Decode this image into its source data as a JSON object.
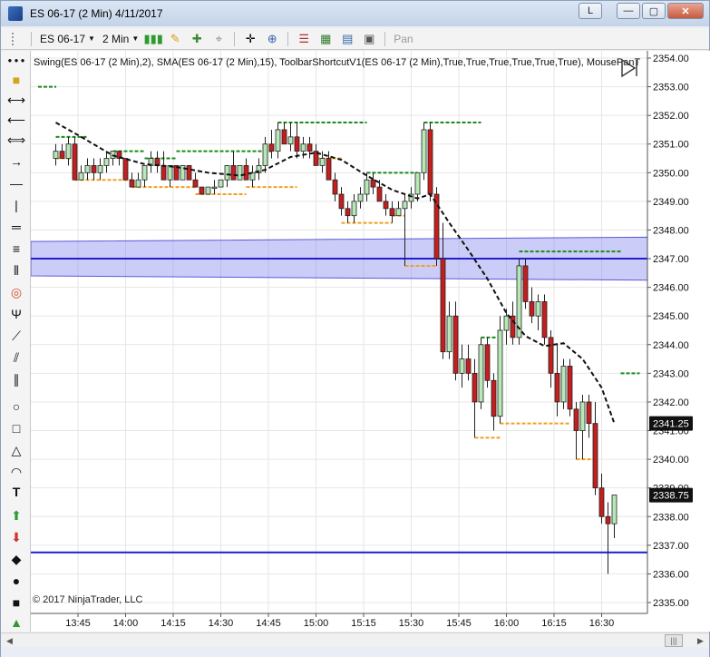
{
  "window": {
    "title": "ES 06-17 (2 Min)  4/11/2017",
    "link_button": "L",
    "minimize": "—",
    "maximize": "▢",
    "close": "✕"
  },
  "toolbar": {
    "instrument": "ES 06-17",
    "interval": "2 Min",
    "pan_label": "Pan"
  },
  "chart": {
    "indicator_label": "Swing(ES 06-17 (2 Min),2), SMA(ES 06-17 (2 Min),15), ToolbarShortcutV1(ES 06-17 (2 Min),True,True,True,True,True,True), MousePanT",
    "copyright": "© 2017 NinjaTrader, LLC",
    "price_badges": [
      {
        "label": "2341.25",
        "value": 2341.25
      },
      {
        "label": "2338.75",
        "value": 2338.75
      }
    ]
  },
  "chart_data": {
    "type": "candlestick",
    "x_ticks": [
      "13:45",
      "14:00",
      "14:15",
      "14:30",
      "14:45",
      "15:00",
      "15:15",
      "15:30",
      "15:45",
      "16:00",
      "16:15",
      "16:30"
    ],
    "y_ticks": [
      "2335.00",
      "2336.00",
      "2337.00",
      "2338.00",
      "2339.00",
      "2340.00",
      "2341.00",
      "2342.00",
      "2343.00",
      "2344.00",
      "2345.00",
      "2346.00",
      "2347.00",
      "2348.00",
      "2349.00",
      "2350.00",
      "2351.00",
      "2352.00",
      "2353.00",
      "2354.00"
    ],
    "ylim": [
      2335,
      2354
    ],
    "grid": true,
    "candles": [
      {
        "t": "13:38",
        "o": 2350.5,
        "h": 2351,
        "l": 2350.25,
        "c": 2350.75
      },
      {
        "t": "13:40",
        "o": 2350.75,
        "h": 2351,
        "l": 2350.5,
        "c": 2350.5
      },
      {
        "t": "13:42",
        "o": 2350.5,
        "h": 2351.25,
        "l": 2350.25,
        "c": 2351
      },
      {
        "t": "13:44",
        "o": 2351,
        "h": 2351.25,
        "l": 2349.75,
        "c": 2349.75
      },
      {
        "t": "13:46",
        "o": 2349.75,
        "h": 2350.25,
        "l": 2349.75,
        "c": 2350
      },
      {
        "t": "13:48",
        "o": 2350,
        "h": 2350.5,
        "l": 2349.75,
        "c": 2350.25
      },
      {
        "t": "13:50",
        "o": 2350.25,
        "h": 2350.5,
        "l": 2349.75,
        "c": 2350
      },
      {
        "t": "13:52",
        "o": 2350,
        "h": 2350.5,
        "l": 2349.75,
        "c": 2350.25
      },
      {
        "t": "13:54",
        "o": 2350.25,
        "h": 2350.75,
        "l": 2350,
        "c": 2350.5
      },
      {
        "t": "13:56",
        "o": 2350.5,
        "h": 2350.75,
        "l": 2350.25,
        "c": 2350.75
      },
      {
        "t": "13:58",
        "o": 2350.75,
        "h": 2350.75,
        "l": 2350.25,
        "c": 2350.5
      },
      {
        "t": "14:00",
        "o": 2350.5,
        "h": 2350.5,
        "l": 2349.75,
        "c": 2349.75
      },
      {
        "t": "14:02",
        "o": 2349.75,
        "h": 2350,
        "l": 2349.5,
        "c": 2349.5
      },
      {
        "t": "14:04",
        "o": 2349.5,
        "h": 2350,
        "l": 2349.5,
        "c": 2349.75
      },
      {
        "t": "14:06",
        "o": 2349.75,
        "h": 2350.25,
        "l": 2349.5,
        "c": 2350.25
      },
      {
        "t": "14:08",
        "o": 2350.25,
        "h": 2350.75,
        "l": 2350,
        "c": 2350.5
      },
      {
        "t": "14:10",
        "o": 2350.5,
        "h": 2350.75,
        "l": 2350,
        "c": 2350.25
      },
      {
        "t": "14:12",
        "o": 2350.25,
        "h": 2350.75,
        "l": 2349.75,
        "c": 2349.75
      },
      {
        "t": "14:14",
        "o": 2349.75,
        "h": 2350.25,
        "l": 2349.5,
        "c": 2350.25
      },
      {
        "t": "14:16",
        "o": 2350.25,
        "h": 2350.25,
        "l": 2349.75,
        "c": 2349.75
      },
      {
        "t": "14:18",
        "o": 2349.75,
        "h": 2350.25,
        "l": 2349.75,
        "c": 2350.25
      },
      {
        "t": "14:20",
        "o": 2350.25,
        "h": 2350.25,
        "l": 2349.75,
        "c": 2349.75
      },
      {
        "t": "14:22",
        "o": 2349.75,
        "h": 2350,
        "l": 2349.5,
        "c": 2349.5
      },
      {
        "t": "14:24",
        "o": 2349.5,
        "h": 2349.5,
        "l": 2349.25,
        "c": 2349.25
      },
      {
        "t": "14:26",
        "o": 2349.25,
        "h": 2349.5,
        "l": 2349.25,
        "c": 2349.5
      },
      {
        "t": "14:28",
        "o": 2349.5,
        "h": 2349.75,
        "l": 2349.25,
        "c": 2349.5
      },
      {
        "t": "14:30",
        "o": 2349.5,
        "h": 2349.75,
        "l": 2349.5,
        "c": 2349.75
      },
      {
        "t": "14:32",
        "o": 2349.75,
        "h": 2350.25,
        "l": 2349.5,
        "c": 2350.25
      },
      {
        "t": "14:34",
        "o": 2350.25,
        "h": 2350.75,
        "l": 2349.75,
        "c": 2349.75
      },
      {
        "t": "14:36",
        "o": 2349.75,
        "h": 2350.25,
        "l": 2349.75,
        "c": 2350.25
      },
      {
        "t": "14:38",
        "o": 2350.25,
        "h": 2350.5,
        "l": 2349.75,
        "c": 2349.75
      },
      {
        "t": "14:40",
        "o": 2349.75,
        "h": 2350.25,
        "l": 2349.5,
        "c": 2350
      },
      {
        "t": "14:42",
        "o": 2350,
        "h": 2350.5,
        "l": 2349.75,
        "c": 2350.25
      },
      {
        "t": "14:44",
        "o": 2350.25,
        "h": 2351.25,
        "l": 2350,
        "c": 2351
      },
      {
        "t": "14:46",
        "o": 2351,
        "h": 2351.5,
        "l": 2350.5,
        "c": 2350.75
      },
      {
        "t": "14:48",
        "o": 2350.75,
        "h": 2351.75,
        "l": 2350.5,
        "c": 2351.5
      },
      {
        "t": "14:50",
        "o": 2351.5,
        "h": 2351.75,
        "l": 2351,
        "c": 2351
      },
      {
        "t": "14:52",
        "o": 2351,
        "h": 2351.75,
        "l": 2350.75,
        "c": 2351.25
      },
      {
        "t": "14:54",
        "o": 2351.25,
        "h": 2351.75,
        "l": 2350.5,
        "c": 2350.75
      },
      {
        "t": "14:56",
        "o": 2350.75,
        "h": 2351.25,
        "l": 2350.5,
        "c": 2351
      },
      {
        "t": "14:58",
        "o": 2351,
        "h": 2351.25,
        "l": 2350.5,
        "c": 2350.75
      },
      {
        "t": "15:00",
        "o": 2350.75,
        "h": 2351,
        "l": 2350.25,
        "c": 2350.25
      },
      {
        "t": "15:02",
        "o": 2350.25,
        "h": 2350.75,
        "l": 2350,
        "c": 2350.5
      },
      {
        "t": "15:04",
        "o": 2350.5,
        "h": 2350.75,
        "l": 2349.75,
        "c": 2349.75
      },
      {
        "t": "15:06",
        "o": 2349.75,
        "h": 2350,
        "l": 2349,
        "c": 2349.25
      },
      {
        "t": "15:08",
        "o": 2349.25,
        "h": 2349.5,
        "l": 2348.5,
        "c": 2348.75
      },
      {
        "t": "15:10",
        "o": 2348.75,
        "h": 2349,
        "l": 2348.25,
        "c": 2348.5
      },
      {
        "t": "15:12",
        "o": 2348.5,
        "h": 2349.25,
        "l": 2348.25,
        "c": 2349
      },
      {
        "t": "15:14",
        "o": 2349,
        "h": 2349.5,
        "l": 2348.75,
        "c": 2349.25
      },
      {
        "t": "15:16",
        "o": 2349.25,
        "h": 2350,
        "l": 2349,
        "c": 2349.75
      },
      {
        "t": "15:18",
        "o": 2349.75,
        "h": 2350,
        "l": 2349.25,
        "c": 2349.5
      },
      {
        "t": "15:20",
        "o": 2349.5,
        "h": 2349.75,
        "l": 2349,
        "c": 2349
      },
      {
        "t": "15:22",
        "o": 2349,
        "h": 2349.25,
        "l": 2348.5,
        "c": 2348.75
      },
      {
        "t": "15:24",
        "o": 2348.75,
        "h": 2349,
        "l": 2348.25,
        "c": 2348.5
      },
      {
        "t": "15:26",
        "o": 2348.5,
        "h": 2349,
        "l": 2348.5,
        "c": 2348.75
      },
      {
        "t": "15:28",
        "o": 2348.75,
        "h": 2349.25,
        "l": 2346.75,
        "c": 2349
      },
      {
        "t": "15:30",
        "o": 2349,
        "h": 2349.5,
        "l": 2348.75,
        "c": 2349.25
      },
      {
        "t": "15:32",
        "o": 2349.25,
        "h": 2350,
        "l": 2349,
        "c": 2350
      },
      {
        "t": "15:34",
        "o": 2350,
        "h": 2351.75,
        "l": 2349.75,
        "c": 2351.5
      },
      {
        "t": "15:36",
        "o": 2351.5,
        "h": 2351.75,
        "l": 2349,
        "c": 2349.25
      },
      {
        "t": "15:38",
        "o": 2349.25,
        "h": 2349.5,
        "l": 2346.75,
        "c": 2347
      },
      {
        "t": "15:40",
        "o": 2347,
        "h": 2348.25,
        "l": 2343.5,
        "c": 2343.75
      },
      {
        "t": "15:42",
        "o": 2343.75,
        "h": 2345.5,
        "l": 2343.5,
        "c": 2345
      },
      {
        "t": "15:44",
        "o": 2345,
        "h": 2345.5,
        "l": 2342.75,
        "c": 2343
      },
      {
        "t": "15:46",
        "o": 2343,
        "h": 2344,
        "l": 2342.5,
        "c": 2343.5
      },
      {
        "t": "15:48",
        "o": 2343.5,
        "h": 2344,
        "l": 2342.75,
        "c": 2343
      },
      {
        "t": "15:50",
        "o": 2343,
        "h": 2343.5,
        "l": 2340.75,
        "c": 2342
      },
      {
        "t": "15:52",
        "o": 2342,
        "h": 2344.25,
        "l": 2341.75,
        "c": 2344
      },
      {
        "t": "15:54",
        "o": 2344,
        "h": 2344.25,
        "l": 2342.5,
        "c": 2342.75
      },
      {
        "t": "15:56",
        "o": 2342.75,
        "h": 2343,
        "l": 2341,
        "c": 2341.5
      },
      {
        "t": "15:58",
        "o": 2341.5,
        "h": 2345,
        "l": 2341.25,
        "c": 2344.5
      },
      {
        "t": "16:00",
        "o": 2344.5,
        "h": 2345.25,
        "l": 2344,
        "c": 2345
      },
      {
        "t": "16:02",
        "o": 2345,
        "h": 2345.5,
        "l": 2344,
        "c": 2344.25
      },
      {
        "t": "16:04",
        "o": 2344.25,
        "h": 2347,
        "l": 2344,
        "c": 2346.75
      },
      {
        "t": "16:06",
        "o": 2346.75,
        "h": 2347,
        "l": 2345.25,
        "c": 2345.5
      },
      {
        "t": "16:08",
        "o": 2345.5,
        "h": 2346,
        "l": 2344.75,
        "c": 2345
      },
      {
        "t": "16:10",
        "o": 2345,
        "h": 2345.75,
        "l": 2344.5,
        "c": 2345.5
      },
      {
        "t": "16:12",
        "o": 2345.5,
        "h": 2345.75,
        "l": 2344,
        "c": 2344.25
      },
      {
        "t": "16:14",
        "o": 2344.25,
        "h": 2344.5,
        "l": 2342.5,
        "c": 2343
      },
      {
        "t": "16:16",
        "o": 2343,
        "h": 2344,
        "l": 2341.5,
        "c": 2342
      },
      {
        "t": "16:18",
        "o": 2342,
        "h": 2343.5,
        "l": 2341.75,
        "c": 2343.25
      },
      {
        "t": "16:20",
        "o": 2343.25,
        "h": 2343.5,
        "l": 2341.5,
        "c": 2341.75
      },
      {
        "t": "16:22",
        "o": 2341.75,
        "h": 2342,
        "l": 2340,
        "c": 2341
      },
      {
        "t": "16:24",
        "o": 2341,
        "h": 2342.25,
        "l": 2340,
        "c": 2342
      },
      {
        "t": "16:26",
        "o": 2342,
        "h": 2342.25,
        "l": 2340.75,
        "c": 2341.25
      },
      {
        "t": "16:28",
        "o": 2341.25,
        "h": 2342,
        "l": 2338.75,
        "c": 2339
      },
      {
        "t": "16:30",
        "o": 2339,
        "h": 2339.5,
        "l": 2337.75,
        "c": 2338
      },
      {
        "t": "16:32",
        "o": 2338,
        "h": 2338.5,
        "l": 2336,
        "c": 2337.75
      },
      {
        "t": "16:34",
        "o": 2337.75,
        "h": 2338.75,
        "l": 2337.25,
        "c": 2338.75
      }
    ],
    "sma": [
      [
        "13:38",
        2351.75
      ],
      [
        "13:46",
        2351.25
      ],
      [
        "13:56",
        2350.6
      ],
      [
        "14:06",
        2350.3
      ],
      [
        "14:16",
        2350.2
      ],
      [
        "14:26",
        2350
      ],
      [
        "14:36",
        2349.9
      ],
      [
        "14:44",
        2350.1
      ],
      [
        "14:52",
        2350.55
      ],
      [
        "15:00",
        2350.7
      ],
      [
        "15:08",
        2350.45
      ],
      [
        "15:16",
        2349.9
      ],
      [
        "15:24",
        2349.4
      ],
      [
        "15:32",
        2349.1
      ],
      [
        "15:36",
        2349.25
      ],
      [
        "15:42",
        2348.25
      ],
      [
        "15:48",
        2347.3
      ],
      [
        "15:54",
        2346.3
      ],
      [
        "16:00",
        2345.1
      ],
      [
        "16:06",
        2344.3
      ],
      [
        "16:12",
        2343.95
      ],
      [
        "16:18",
        2344.05
      ],
      [
        "16:24",
        2343.5
      ],
      [
        "16:30",
        2342.5
      ],
      [
        "16:34",
        2341.25
      ]
    ],
    "swing_high": [
      [
        "13:38",
        "13:48",
        2351.25
      ],
      [
        "13:56",
        "14:06",
        2350.75
      ],
      [
        "14:06",
        "14:16",
        2350.5
      ],
      [
        "14:16",
        "14:46",
        2350.75
      ],
      [
        "14:48",
        "15:16",
        2351.75
      ],
      [
        "15:16",
        "15:32",
        2350
      ],
      [
        "15:34",
        "15:52",
        2351.75
      ],
      [
        "15:52",
        "15:58",
        2344.25
      ],
      [
        "16:04",
        "16:36",
        2347.25
      ],
      [
        "16:36",
        "16:42",
        2343
      ]
    ],
    "swing_low": [
      [
        "13:38",
        "13:44",
        2350.5
      ],
      [
        "13:44",
        "14:02",
        2349.75
      ],
      [
        "14:02",
        "14:22",
        2349.5
      ],
      [
        "14:22",
        "14:38",
        2349.25
      ],
      [
        "14:38",
        "14:54",
        2349.5
      ],
      [
        "15:00",
        "15:08",
        2350.5
      ],
      [
        "15:08",
        "15:24",
        2348.25
      ],
      [
        "15:24",
        "15:28",
        2348.5
      ],
      [
        "15:28",
        "15:38",
        2346.75
      ],
      [
        "15:50",
        "15:58",
        2340.75
      ],
      [
        "15:58",
        "16:20",
        2341.25
      ],
      [
        "16:22",
        "16:28",
        2340
      ]
    ],
    "h_lines": [
      2347,
      2336.75
    ],
    "channel": {
      "upper": [
        2347.6,
        2347.75
      ],
      "lower": [
        2346.4,
        2346.25
      ]
    }
  }
}
